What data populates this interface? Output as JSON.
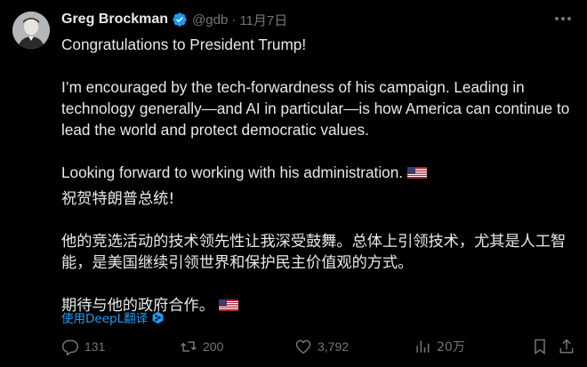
{
  "author": {
    "name": "Greg Brockman",
    "handle": "@gdb",
    "date": "11月7日"
  },
  "tweet": {
    "line1": "Congratulations to President Trump!",
    "para2_lines": [
      "I’m encouraged by the tech-forwardness of his campaign. Leading in",
      "technology generally—and AI in particular—is how America can continue to",
      "lead the world and protect democratic values."
    ],
    "line3": "Looking forward to working with his administration.",
    "cjk1": "祝贺特朗普总统!",
    "cjk2_lines": [
      "他的竞选活动的技术领先性让我深受鼓舞。总体上引领技术，尤其是人工智",
      "能，是美国继续引领世界和保护民主价值观的方式。"
    ],
    "cjk3": "期待与他的政府合作。",
    "flag_icon": "us-flag-icon"
  },
  "translate_label": "使用DeepL翻译",
  "actions": {
    "replies": "131",
    "reposts": "200",
    "likes": "3,792",
    "views": "20万"
  },
  "colors": {
    "background": "#000000",
    "text": "#e7e9ea",
    "muted": "#71767b",
    "accent": "#1d9bf0"
  }
}
